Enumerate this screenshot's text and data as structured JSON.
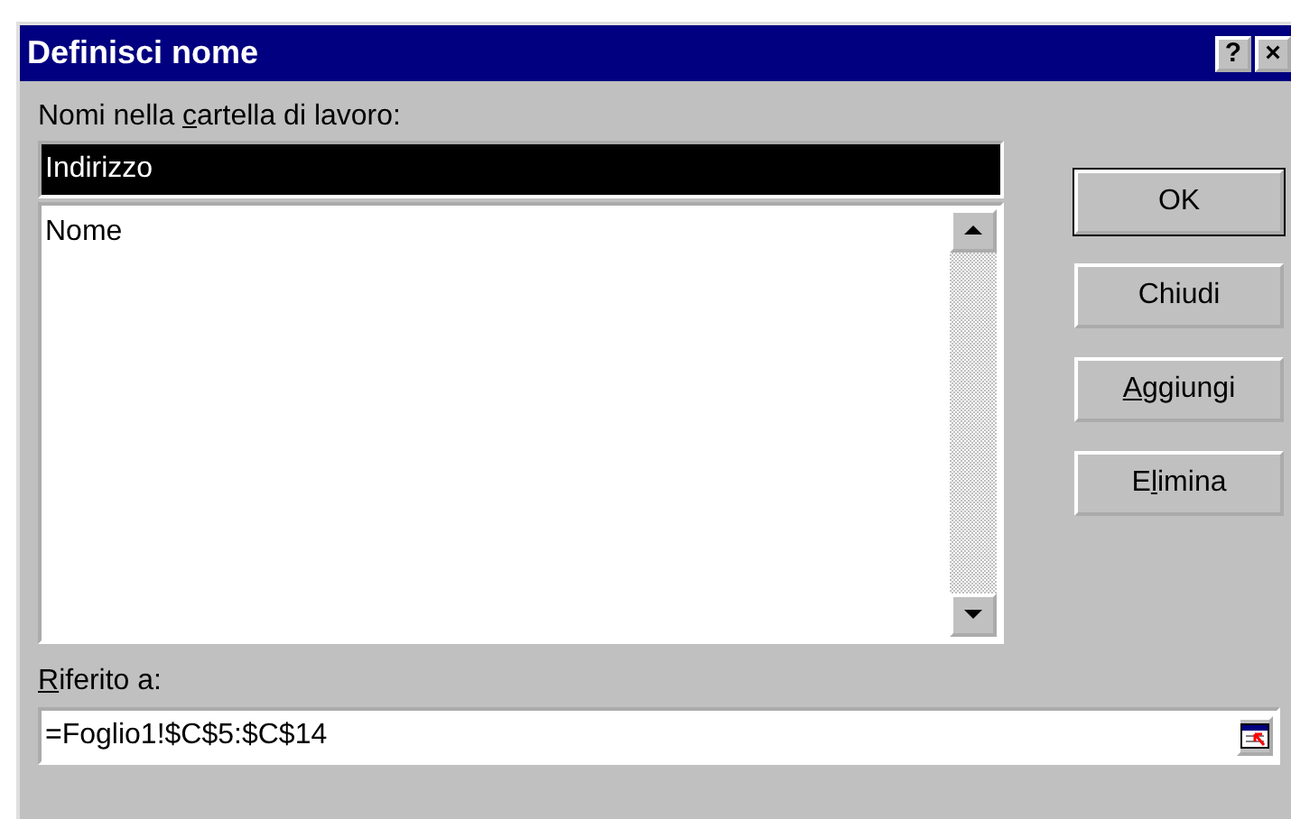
{
  "window": {
    "title": "Definisci nome",
    "help_button": "?",
    "close_button": "×"
  },
  "names_label": [
    {
      "text": "Nomi nella ",
      "underline": false
    },
    {
      "text": "c",
      "underline": true
    },
    {
      "text": "artella di lavoro:",
      "underline": false
    }
  ],
  "name_field": {
    "value": "Indirizzo",
    "selected": true
  },
  "names_list": {
    "items": [
      {
        "label": "Nome",
        "selected": false
      }
    ]
  },
  "buttons": [
    {
      "parts": [
        {
          "text": "OK",
          "underline": false
        }
      ],
      "default": true
    },
    {
      "parts": [
        {
          "text": "Chiudi",
          "underline": false
        }
      ],
      "default": false
    },
    {
      "parts": [
        {
          "text": "A",
          "underline": true
        },
        {
          "text": "ggiungi",
          "underline": false
        }
      ],
      "default": false
    },
    {
      "parts": [
        {
          "text": "E",
          "underline": false
        },
        {
          "text": "l",
          "underline": true
        },
        {
          "text": "imina",
          "underline": false
        }
      ],
      "default": false
    }
  ],
  "refers_label": [
    {
      "text": "R",
      "underline": true
    },
    {
      "text": "iferito a:",
      "underline": false
    }
  ],
  "refers_field": {
    "value": "=Foglio1!$C$5:$C$14"
  }
}
